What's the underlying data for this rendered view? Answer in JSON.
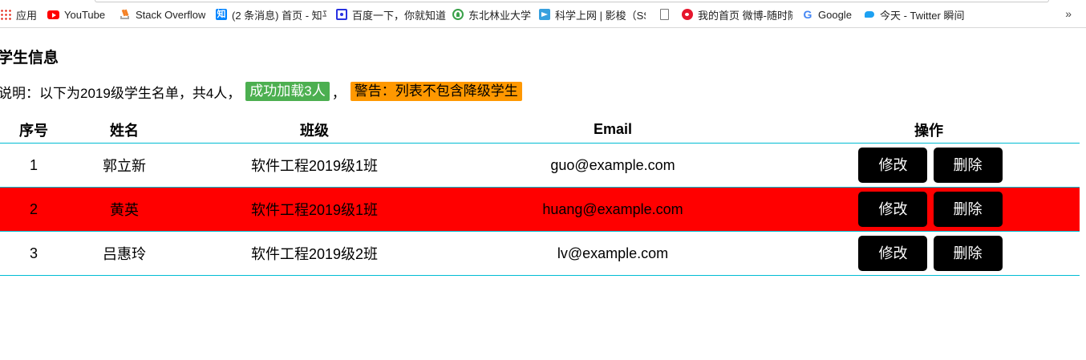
{
  "bookmarks": [
    {
      "label": "应用",
      "icon": "apps-grid-icon"
    },
    {
      "label": "YouTube",
      "icon": "youtube-icon"
    },
    {
      "label": "Stack Overflow",
      "icon": "stackoverflow-icon"
    },
    {
      "label": "(2 条消息) 首页 - 知平",
      "icon": "zhihu-icon"
    },
    {
      "label": "百度一下，你就知道",
      "icon": "baidu-icon"
    },
    {
      "label": "东北林业大学",
      "icon": "nefu-icon"
    },
    {
      "label": "科学上网 | 影梭（SS",
      "icon": "telegram-icon"
    },
    {
      "label": "",
      "icon": "document-icon"
    },
    {
      "label": "我的首页 微博-随时随",
      "icon": "weibo-icon"
    },
    {
      "label": "Google",
      "icon": "google-icon"
    },
    {
      "label": "今天 - Twitter 瞬间",
      "icon": "twitter-icon"
    }
  ],
  "bookmarks_more": "»",
  "page": {
    "title": "学生信息",
    "description_prefix": "说明：以下为2019级学生名单，共4人，",
    "success_badge": "成功加载3人",
    "separator": "，",
    "warning_badge": "警告：列表不包含降级学生"
  },
  "table": {
    "headers": [
      "序号",
      "姓名",
      "班级",
      "Email",
      "操作"
    ],
    "rows": [
      {
        "no": "1",
        "name": "郭立新",
        "class": "软件工程2019级1班",
        "email": "guo@example.com",
        "edit": "修改",
        "delete": "删除"
      },
      {
        "no": "2",
        "name": "黄英",
        "class": "软件工程2019级1班",
        "email": "huang@example.com",
        "edit": "修改",
        "delete": "删除"
      },
      {
        "no": "3",
        "name": "吕惠玲",
        "class": "软件工程2019级2班",
        "email": "lv@example.com",
        "edit": "修改",
        "delete": "删除"
      }
    ]
  },
  "colors": {
    "success": "#4caf50",
    "warning": "#ff9800",
    "highlight_row": "#ff0000",
    "row_border": "#00bcd4",
    "button": "#000000"
  }
}
